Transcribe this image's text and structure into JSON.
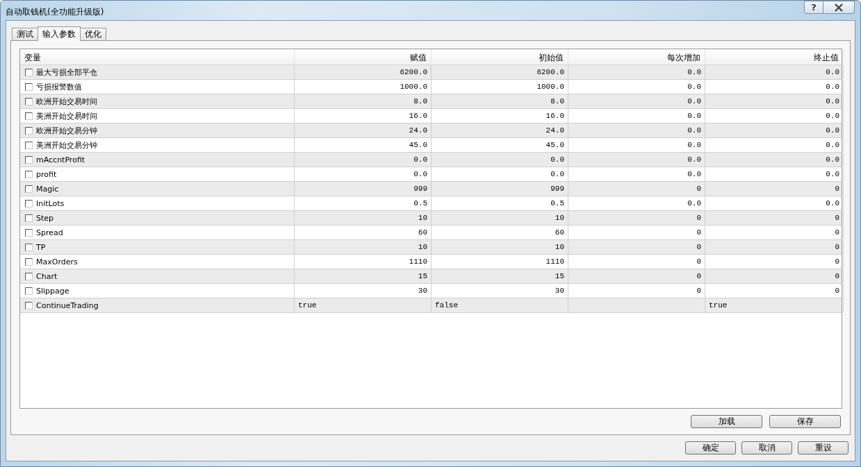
{
  "window": {
    "title": "自动取钱机(全功能升级版)",
    "help_button": "?"
  },
  "tabs": [
    {
      "label": "测试",
      "selected": false
    },
    {
      "label": "输入参数",
      "selected": true
    },
    {
      "label": "优化",
      "selected": false
    }
  ],
  "table": {
    "columns": [
      "变量",
      "赋值",
      "初始值",
      "每次增加",
      "终止值"
    ],
    "rows": [
      {
        "kind": "numeric",
        "checked": false,
        "cells": [
          "最大亏损全部平仓",
          "6200.0",
          "6200.0",
          "0.0",
          "0.0"
        ]
      },
      {
        "kind": "numeric",
        "checked": false,
        "cells": [
          "亏损报警数值",
          "1000.0",
          "1000.0",
          "0.0",
          "0.0"
        ]
      },
      {
        "kind": "numeric",
        "checked": false,
        "cells": [
          "欧洲开始交易时间",
          "8.0",
          "8.0",
          "0.0",
          "0.0"
        ]
      },
      {
        "kind": "numeric",
        "checked": false,
        "cells": [
          "美洲开始交易时间",
          "16.0",
          "16.0",
          "0.0",
          "0.0"
        ]
      },
      {
        "kind": "numeric",
        "checked": false,
        "cells": [
          "欧洲开始交易分钟",
          "24.0",
          "24.0",
          "0.0",
          "0.0"
        ]
      },
      {
        "kind": "numeric",
        "checked": false,
        "cells": [
          "美洲开始交易分钟",
          "45.0",
          "45.0",
          "0.0",
          "0.0"
        ]
      },
      {
        "kind": "numeric",
        "checked": false,
        "cells": [
          "mAccntProfit",
          "0.0",
          "0.0",
          "0.0",
          "0.0"
        ]
      },
      {
        "kind": "numeric",
        "checked": false,
        "cells": [
          "profit",
          "0.0",
          "0.0",
          "0.0",
          "0.0"
        ]
      },
      {
        "kind": "numeric",
        "checked": false,
        "cells": [
          "Magic",
          "999",
          "999",
          "0",
          "0"
        ]
      },
      {
        "kind": "numeric",
        "checked": false,
        "cells": [
          "InitLots",
          "0.5",
          "0.5",
          "0.0",
          "0.0"
        ]
      },
      {
        "kind": "numeric",
        "checked": false,
        "cells": [
          "Step",
          "10",
          "10",
          "0",
          "0"
        ]
      },
      {
        "kind": "numeric",
        "checked": false,
        "cells": [
          "Spread",
          "60",
          "60",
          "0",
          "0"
        ]
      },
      {
        "kind": "numeric",
        "checked": false,
        "cells": [
          "TP",
          "10",
          "10",
          "0",
          "0"
        ]
      },
      {
        "kind": "numeric",
        "checked": false,
        "cells": [
          "MaxOrders",
          "1110",
          "1110",
          "0",
          "0"
        ]
      },
      {
        "kind": "numeric",
        "checked": false,
        "cells": [
          "Chart",
          "15",
          "15",
          "0",
          "0"
        ]
      },
      {
        "kind": "numeric",
        "checked": false,
        "cells": [
          "Slippage",
          "30",
          "30",
          "0",
          "0"
        ]
      },
      {
        "kind": "boolean",
        "checked": false,
        "cells": [
          "ContinueTrading",
          "true",
          "false",
          "",
          "true"
        ]
      }
    ]
  },
  "panel_buttons": [
    "加载",
    "保存"
  ],
  "dialog_buttons": [
    "确定",
    "取消",
    "重设"
  ]
}
